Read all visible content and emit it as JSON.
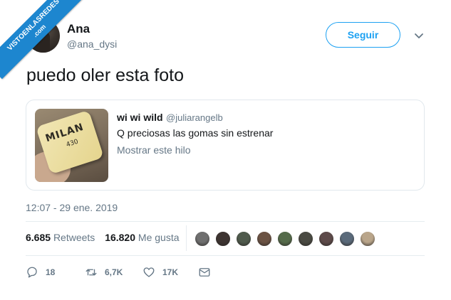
{
  "watermark": {
    "line1": "VISTOENLASREDES",
    "line2": ".com"
  },
  "author": {
    "name": "Ana",
    "handle": "@ana_dysi"
  },
  "follow_label": "Seguir",
  "tweet_text": "puedo oler esta foto",
  "quoted": {
    "name": "wi wi wild",
    "handle": "@juliarangelb",
    "text": "Q preciosas las gomas sin estrenar",
    "show_thread": "Mostrar este hilo",
    "image_brand": "MILAN",
    "image_number": "430"
  },
  "timestamp": "12:07 - 29 ene. 2019",
  "stats": {
    "retweets_count": "6.685",
    "retweets_label": "Retweets",
    "likes_count": "16.820",
    "likes_label": "Me gusta"
  },
  "liker_colors": [
    "#6f6f6f",
    "#3d3431",
    "#4f5a4c",
    "#6b5243",
    "#556b4a",
    "#4a4a42",
    "#5d4a49",
    "#5a6a7a",
    "#b9a58a"
  ],
  "actions": {
    "replies": "18",
    "retweets": "6,7K",
    "likes": "17K"
  },
  "colors": {
    "accent": "#1da1f2",
    "muted": "#657786",
    "text": "#14171a",
    "watermark_bg": "#1d86cf"
  },
  "icons": [
    "chevron-down-icon",
    "reply-icon",
    "retweet-icon",
    "heart-icon",
    "message-icon"
  ]
}
